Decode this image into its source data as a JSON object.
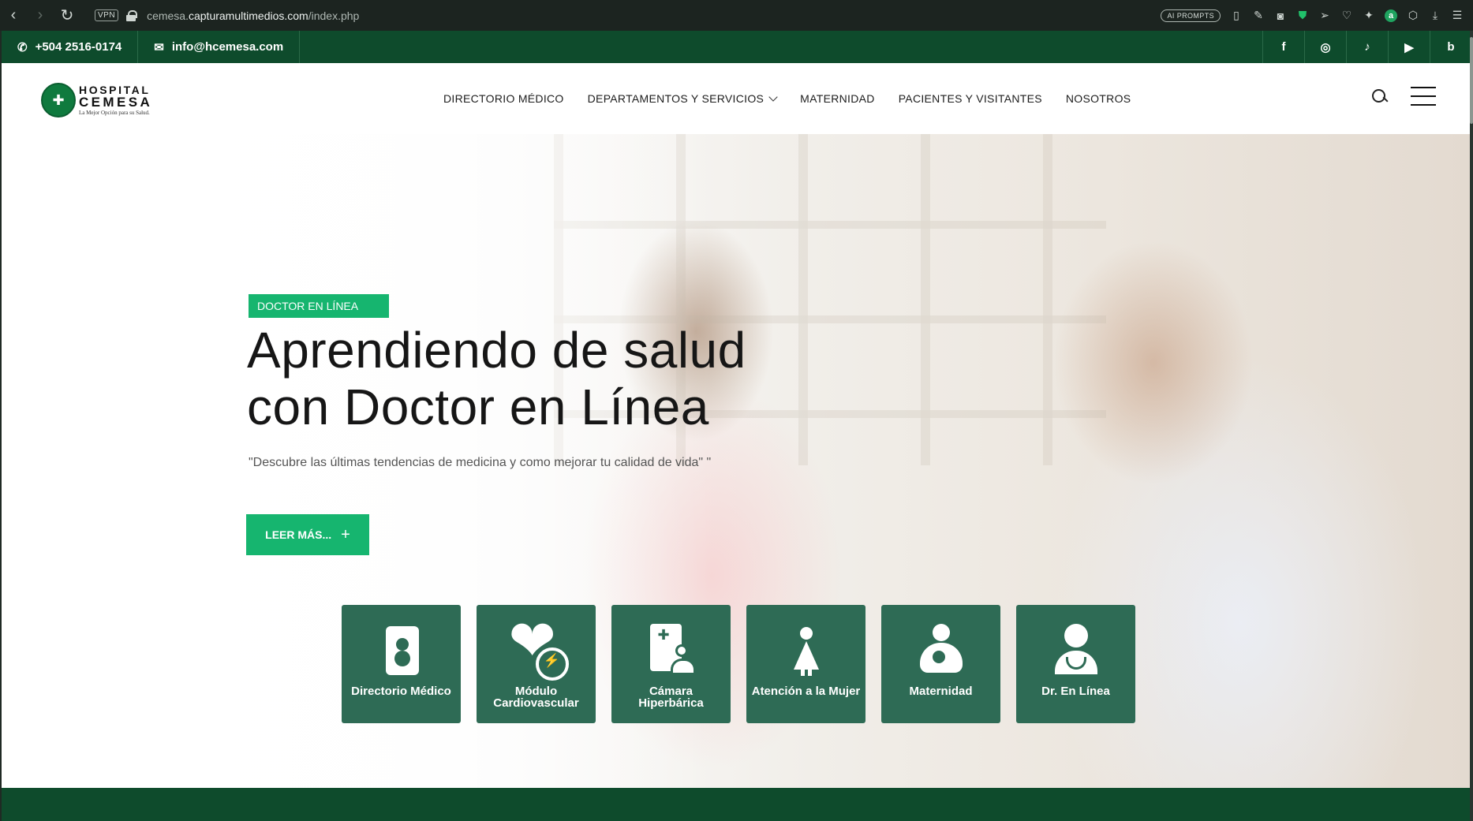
{
  "browser": {
    "url_prefix": "cemesa.",
    "url_domain": "capturamultimedios.com",
    "url_path": "/index.php",
    "vpn_label": "VPN",
    "ai_prompts_label": "AI PROMPTS"
  },
  "topbar": {
    "phone": "+504 2516-0174",
    "email": "info@hcemesa.com",
    "social": [
      {
        "name": "facebook",
        "glyph": "f"
      },
      {
        "name": "instagram",
        "glyph": "◎"
      },
      {
        "name": "tiktok",
        "glyph": "♪"
      },
      {
        "name": "youtube",
        "glyph": "▶"
      },
      {
        "name": "blog",
        "glyph": "b"
      }
    ]
  },
  "logo": {
    "line1": "HOSPITAL",
    "line2": "CEMESA",
    "tagline": "La Mejor Opción para su Salud."
  },
  "nav": {
    "items": [
      {
        "label": "DIRECTORIO MÉDICO"
      },
      {
        "label": "DEPARTAMENTOS Y SERVICIOS",
        "has_dropdown": true
      },
      {
        "label": "MATERNIDAD"
      },
      {
        "label": "PACIENTES Y VISITANTES"
      },
      {
        "label": "NOSOTROS"
      }
    ]
  },
  "hero": {
    "badge": "DOCTOR EN LÍNEA",
    "title": "Aprendiendo de salud con Doctor en Línea",
    "subtitle": "\"Descubre las últimas tendencias de medicina y como mejorar tu calidad de vida\" \"",
    "cta_label": "LEER MÁS...",
    "cta_icon": "+"
  },
  "tiles": [
    {
      "label": "Directorio Médico",
      "icon": "contact-book-icon"
    },
    {
      "label": "Módulo Cardiovascular",
      "icon": "heart-pulse-icon"
    },
    {
      "label": "Cámara Hiperbárica",
      "icon": "medical-record-icon"
    },
    {
      "label": "Atención a la Mujer",
      "icon": "woman-icon"
    },
    {
      "label": "Maternidad",
      "icon": "mother-baby-icon"
    },
    {
      "label": "Dr. En Línea",
      "icon": "doctor-icon"
    }
  ],
  "colors": {
    "brand_dark_green": "#0e4b2c",
    "accent_green": "#16b56f",
    "tile_green": "#2e6b55"
  }
}
